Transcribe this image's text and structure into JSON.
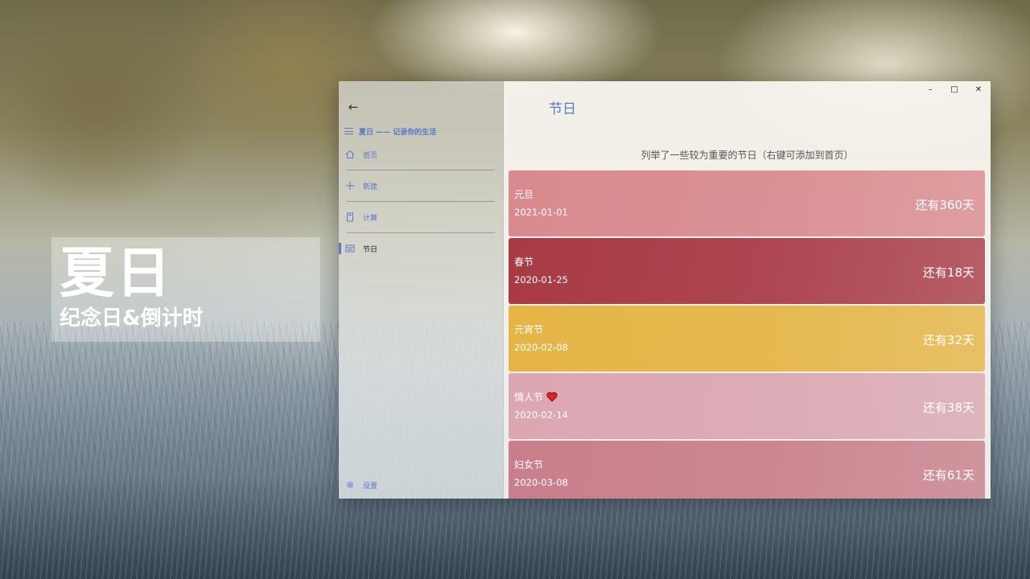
{
  "promo": {
    "title": "夏日",
    "subtitle": "纪念日&倒计时"
  },
  "window": {
    "controls": {
      "minimize": "–",
      "maximize": "□",
      "close": "✕"
    }
  },
  "sidebar": {
    "back_icon": "back-arrow-icon",
    "app_title": "夏日 —— 记录你的生活",
    "items": [
      {
        "label": "首页",
        "icon": "home-icon"
      },
      {
        "label": "新建",
        "icon": "plus-icon"
      },
      {
        "label": "计算",
        "icon": "calculator-icon"
      },
      {
        "label": "节日",
        "icon": "calendar-icon",
        "active": true
      }
    ],
    "settings_label": "设置",
    "accent": "#5b78c9"
  },
  "main": {
    "title": "节日",
    "description": "列举了一些较为重要的节日（右键可添加到首页）",
    "holidays": [
      {
        "name": "元旦",
        "date": "2021-01-01",
        "remaining": "还有360天",
        "color": "#d98a8f"
      },
      {
        "name": "春节",
        "date": "2020-01-25",
        "remaining": "还有18天",
        "color": "#a83a45"
      },
      {
        "name": "元宵节",
        "date": "2020-02-08",
        "remaining": "还有32天",
        "color": "#e5b545"
      },
      {
        "name": "情人节",
        "date": "2020-02-14",
        "remaining": "还有38天",
        "color": "#dba7b2",
        "heart": true
      },
      {
        "name": "妇女节",
        "date": "2020-03-08",
        "remaining": "还有61天",
        "color": "#c97f8b"
      }
    ]
  }
}
